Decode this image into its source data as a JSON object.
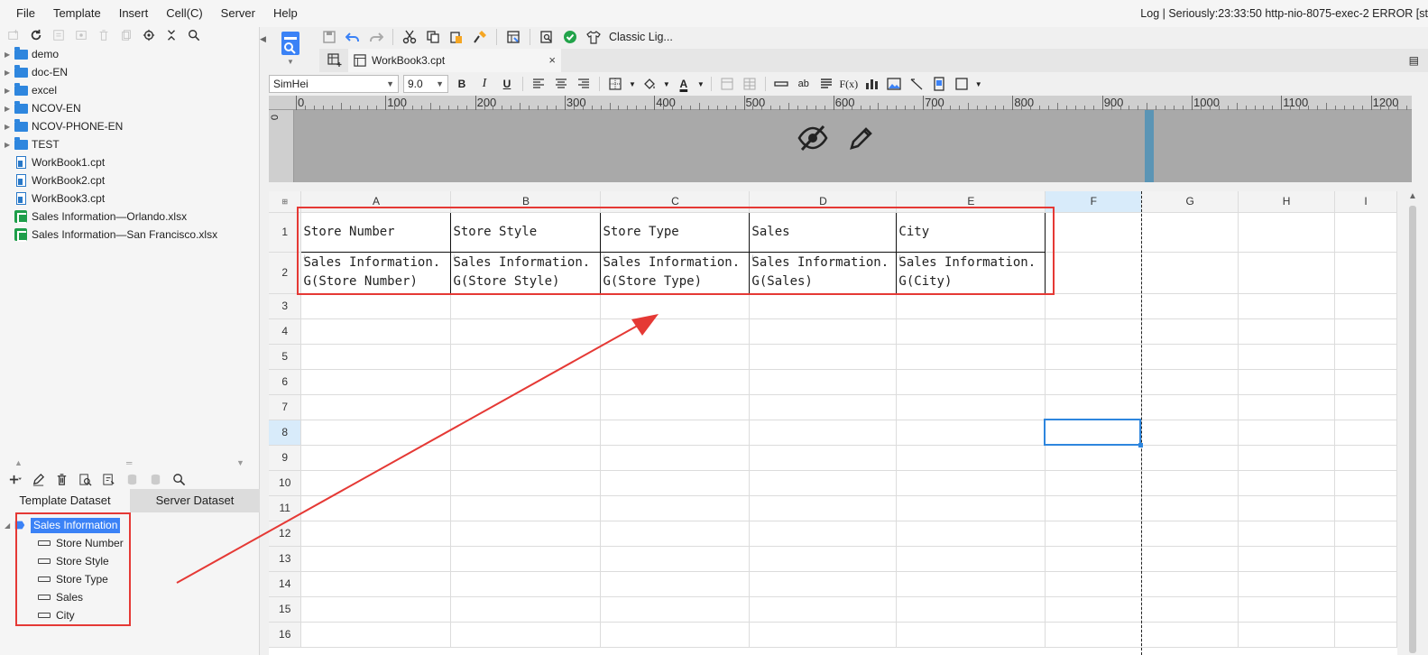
{
  "menu": [
    "File",
    "Template",
    "Insert",
    "Cell(C)",
    "Server",
    "Help"
  ],
  "log_text": "Log | Seriously:23:33:50 http-nio-8075-exec-2 ERROR [st",
  "file_tree": [
    {
      "type": "folder",
      "label": "demo"
    },
    {
      "type": "folder",
      "label": "doc-EN"
    },
    {
      "type": "folder",
      "label": "excel"
    },
    {
      "type": "folder",
      "label": "NCOV-EN"
    },
    {
      "type": "folder",
      "label": "NCOV-PHONE-EN"
    },
    {
      "type": "folder",
      "label": "TEST"
    },
    {
      "type": "cpt",
      "label": "WorkBook1.cpt"
    },
    {
      "type": "cpt",
      "label": "WorkBook2.cpt"
    },
    {
      "type": "cpt",
      "label": "WorkBook3.cpt"
    },
    {
      "type": "xlsx",
      "label": "Sales Information—Orlando.xlsx"
    },
    {
      "type": "xlsx",
      "label": "Sales Information—San Francisco.xlsx"
    }
  ],
  "dataset_tabs": {
    "template": "Template Dataset",
    "server": "Server Dataset"
  },
  "dataset_tree": {
    "root": "Sales Information",
    "fields": [
      "Store Number",
      "Store Style",
      "Store Type",
      "Sales",
      "City"
    ]
  },
  "toolbar": {
    "style_label": "Classic Lig..."
  },
  "tab": {
    "title": "WorkBook3.cpt",
    "close": "×"
  },
  "format": {
    "font": "SimHei",
    "size": "9.0",
    "bold": "B",
    "italic": "I",
    "underline": "U",
    "font_color_glyph": "A"
  },
  "ruler": {
    "zero": "0",
    "labels": [
      "0",
      "100",
      "200",
      "300",
      "400",
      "500",
      "600",
      "700",
      "800",
      "900",
      "1000",
      "1100",
      "1200"
    ]
  },
  "grid": {
    "corner": "⊞",
    "columns": [
      "A",
      "B",
      "C",
      "D",
      "E",
      "F",
      "G",
      "H",
      "I"
    ],
    "rows": [
      "1",
      "2",
      "3",
      "4",
      "5",
      "6",
      "7",
      "8",
      "9",
      "10",
      "11",
      "12",
      "13",
      "14",
      "15",
      "16"
    ],
    "row1": [
      "Store Number",
      "Store Style",
      "Store Type",
      "Sales",
      "City"
    ],
    "row2_line1": [
      "Sales Information.",
      "Sales Information.",
      "Sales Information.",
      "Sales Information.",
      "Sales Information."
    ],
    "row2_line2": [
      "G(Store Number)",
      "G(Store Style)",
      "G(Store Type)",
      "G(Sales)",
      "G(City)"
    ],
    "selected_cell": "F8"
  },
  "colors": {
    "accent": "#2e86de",
    "annotation": "#e53935",
    "selection_header": "#d8ebfa"
  },
  "icons": [
    "add-icon",
    "refresh-icon",
    "search-icon",
    "locate-icon",
    "undo-icon",
    "redo-icon",
    "cut-icon",
    "copy-icon",
    "paste-icon",
    "format-painter-icon",
    "preview-icon",
    "check-icon",
    "shirt-icon",
    "eye-off-icon",
    "pencil-icon"
  ]
}
